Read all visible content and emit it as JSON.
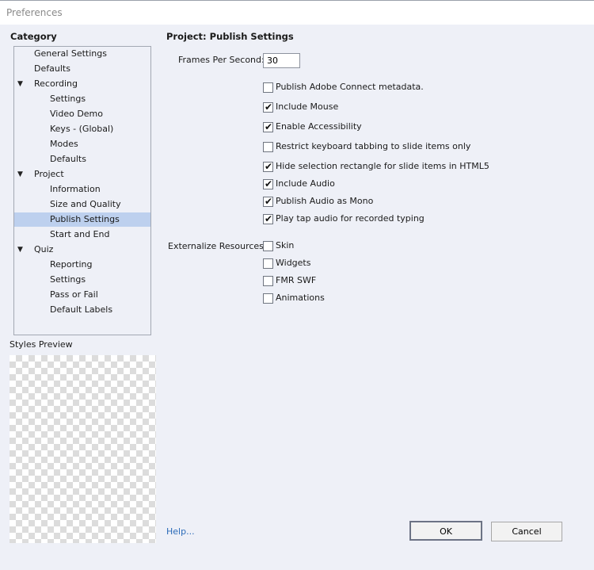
{
  "window": {
    "title": "Preferences"
  },
  "category": {
    "heading": "Category",
    "items": [
      {
        "label": "General Settings",
        "indent": 0,
        "expander": false,
        "selected": false
      },
      {
        "label": "Defaults",
        "indent": 0,
        "expander": false,
        "selected": false
      },
      {
        "label": "Recording",
        "indent": 0,
        "expander": true,
        "selected": false
      },
      {
        "label": "Settings",
        "indent": 1,
        "expander": false,
        "selected": false
      },
      {
        "label": "Video Demo",
        "indent": 1,
        "expander": false,
        "selected": false
      },
      {
        "label": "Keys - (Global)",
        "indent": 1,
        "expander": false,
        "selected": false
      },
      {
        "label": "Modes",
        "indent": 1,
        "expander": false,
        "selected": false
      },
      {
        "label": "Defaults",
        "indent": 1,
        "expander": false,
        "selected": false
      },
      {
        "label": "Project",
        "indent": 0,
        "expander": true,
        "selected": false
      },
      {
        "label": "Information",
        "indent": 1,
        "expander": false,
        "selected": false
      },
      {
        "label": "Size and Quality",
        "indent": 1,
        "expander": false,
        "selected": false
      },
      {
        "label": "Publish Settings",
        "indent": 1,
        "expander": false,
        "selected": true
      },
      {
        "label": "Start and End",
        "indent": 1,
        "expander": false,
        "selected": false
      },
      {
        "label": "Quiz",
        "indent": 0,
        "expander": true,
        "selected": false
      },
      {
        "label": "Reporting",
        "indent": 1,
        "expander": false,
        "selected": false
      },
      {
        "label": "Settings",
        "indent": 1,
        "expander": false,
        "selected": false
      },
      {
        "label": "Pass or Fail",
        "indent": 1,
        "expander": false,
        "selected": false
      },
      {
        "label": "Default Labels",
        "indent": 1,
        "expander": false,
        "selected": false
      }
    ],
    "expander_glyph": "▼"
  },
  "styles_preview": {
    "label": "Styles Preview"
  },
  "panel": {
    "title": "Project: Publish Settings",
    "fps_label": "Frames Per Second:",
    "fps_value": "30",
    "options": [
      {
        "label": "Publish Adobe Connect metadata.",
        "checked": false
      },
      {
        "label": "Include Mouse",
        "checked": true
      },
      {
        "label": "Enable Accessibility",
        "checked": true
      },
      {
        "label": "Restrict keyboard tabbing to slide items only",
        "checked": false
      },
      {
        "label": "Hide selection rectangle for slide items in HTML5",
        "checked": true
      },
      {
        "label": "Include Audio",
        "checked": true
      },
      {
        "label": "Publish Audio as Mono",
        "checked": true
      },
      {
        "label": "Play tap audio for recorded typing",
        "checked": true
      }
    ],
    "externalize_label": "Externalize Resources:",
    "externalize": [
      {
        "label": "Skin",
        "checked": false
      },
      {
        "label": "Widgets",
        "checked": false
      },
      {
        "label": "FMR SWF",
        "checked": false
      },
      {
        "label": "Animations",
        "checked": false
      }
    ],
    "check_glyph": "✔"
  },
  "footer": {
    "help": "Help...",
    "ok": "OK",
    "cancel": "Cancel"
  }
}
